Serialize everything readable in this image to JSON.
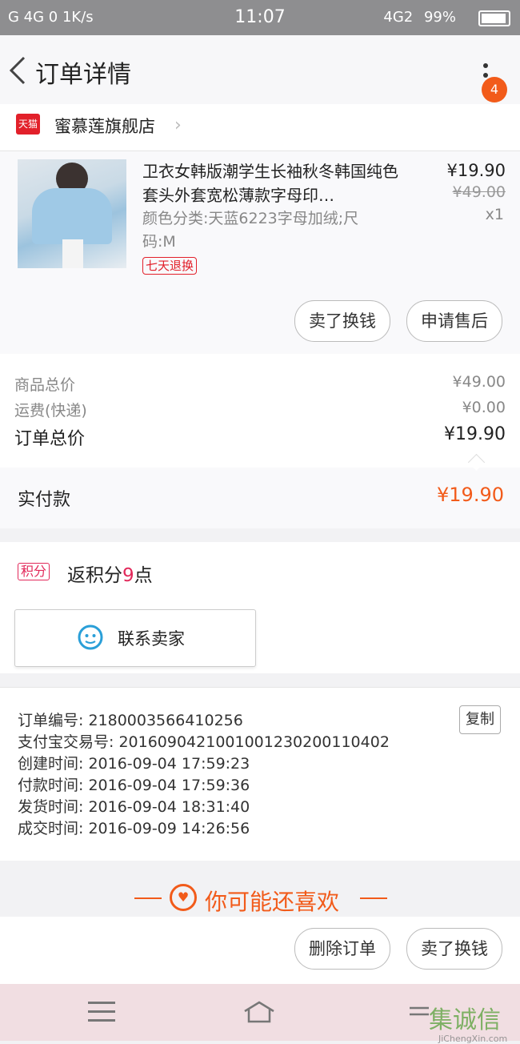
{
  "status_bar": {
    "left": "G 4G 0 1K/s",
    "time": "11:07",
    "network": "4G2",
    "battery": "99%"
  },
  "header": {
    "title": "订单详情",
    "badge_count": "4"
  },
  "store": {
    "platform_label": "天猫",
    "name": "蜜慕莲旗舰店"
  },
  "product": {
    "title": "卫衣女韩版潮学生长袖秋冬韩国纯色套头外套宽松薄款字母印…",
    "spec": "颜色分类:天蓝6223字母加绒;尺码:M",
    "return_tag": "七天退换",
    "price": "¥19.90",
    "original_price": "¥49.00",
    "quantity": "x1",
    "buttons": [
      "卖了换钱",
      "申请售后"
    ]
  },
  "totals": {
    "goods_label": "商品总价",
    "goods_value": "¥49.00",
    "shipping_label": "运费(快递)",
    "shipping_value": "¥0.00",
    "order_label": "订单总价",
    "order_value": "¥19.90",
    "paid_label": "实付款",
    "paid_value": "¥19.90"
  },
  "points": {
    "tag": "积分",
    "text_prefix": "返积分",
    "number": "9",
    "text_suffix": "点"
  },
  "contact": {
    "label": "联系卖家"
  },
  "order_info": {
    "order_no": "订单编号: 2180003566410256",
    "copy_label": "复制",
    "alipay_no": "支付宝交易号: 2016090421001001230200110402",
    "created": "创建时间: 2016-09-04  17:59:23",
    "paid": "付款时间: 2016-09-04  17:59:36",
    "shipped": "发货时间: 2016-09-04  18:31:40",
    "closed": "成交时间: 2016-09-09  14:26:56"
  },
  "recommend": {
    "title": "你可能还喜欢"
  },
  "actions": {
    "delete": "删除订单",
    "resell": "卖了换钱"
  },
  "watermark": {
    "text": "集诚信",
    "url": "JiChengXin.com"
  },
  "colors": {
    "accent": "#f25b1a",
    "tmall_red": "#e2202a",
    "points_pink": "#e2285a"
  }
}
